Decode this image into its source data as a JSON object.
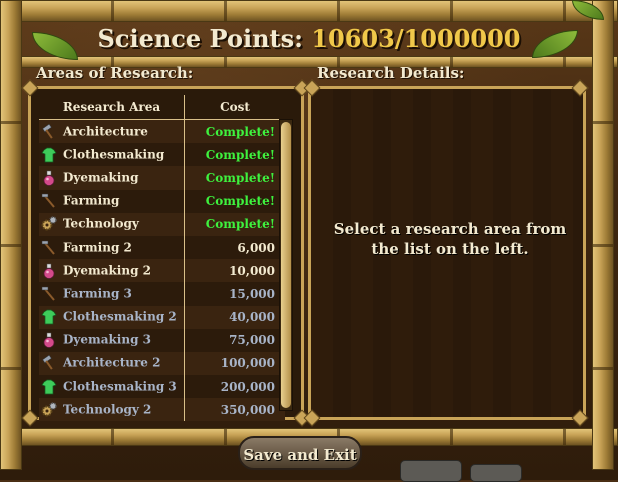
{
  "header": {
    "label": "Science Points:",
    "value": "10603/1000000"
  },
  "areas_heading": "Areas of Research:",
  "details_heading": "Research Details:",
  "table": {
    "columns": [
      "Research Area",
      "Cost"
    ],
    "rows": [
      {
        "icon": "hammer-icon",
        "name": "Architecture",
        "cost": "Complete!",
        "status": "complete"
      },
      {
        "icon": "shirt-icon",
        "name": "Clothesmaking",
        "cost": "Complete!",
        "status": "complete"
      },
      {
        "icon": "potion-icon",
        "name": "Dyemaking",
        "cost": "Complete!",
        "status": "complete"
      },
      {
        "icon": "hoe-icon",
        "name": "Farming",
        "cost": "Complete!",
        "status": "complete"
      },
      {
        "icon": "gears-icon",
        "name": "Technology",
        "cost": "Complete!",
        "status": "complete"
      },
      {
        "icon": "hoe-icon",
        "name": "Farming 2",
        "cost": "6,000",
        "status": "available"
      },
      {
        "icon": "potion-icon",
        "name": "Dyemaking 2",
        "cost": "10,000",
        "status": "available"
      },
      {
        "icon": "hoe-icon",
        "name": "Farming 3",
        "cost": "15,000",
        "status": "locked"
      },
      {
        "icon": "shirt-icon",
        "name": "Clothesmaking 2",
        "cost": "40,000",
        "status": "locked"
      },
      {
        "icon": "potion-icon",
        "name": "Dyemaking 3",
        "cost": "75,000",
        "status": "locked"
      },
      {
        "icon": "hammer-icon",
        "name": "Architecture 2",
        "cost": "100,000",
        "status": "locked"
      },
      {
        "icon": "shirt-icon",
        "name": "Clothesmaking 3",
        "cost": "200,000",
        "status": "locked"
      },
      {
        "icon": "gears-icon",
        "name": "Technology 2",
        "cost": "350,000",
        "status": "locked"
      }
    ]
  },
  "details_message": "Select a research area from the list on the left.",
  "exit_label": "Save and Exit",
  "colors": {
    "complete": "#3ef23e",
    "locked": "#a8b4c8",
    "value": "#f0c84a"
  }
}
